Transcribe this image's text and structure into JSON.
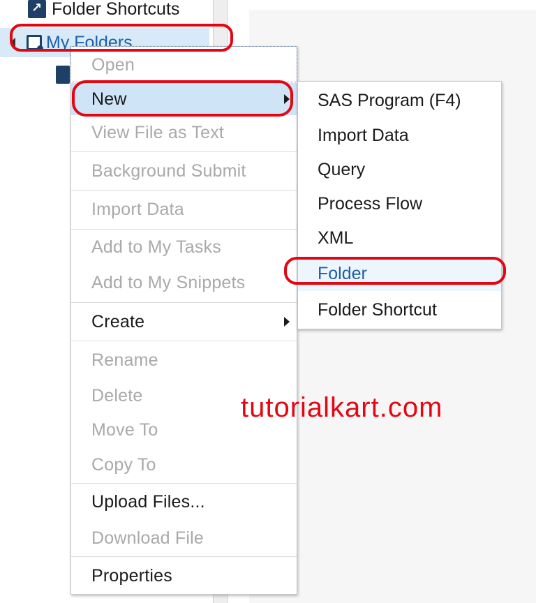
{
  "tree": {
    "folder_shortcuts_label": "Folder Shortcuts",
    "my_folders_label": "My Folders"
  },
  "context_menu": {
    "items": [
      {
        "label": "Open"
      },
      {
        "label": "New"
      },
      {
        "label": "View File as Text"
      },
      {
        "label": "Background Submit"
      },
      {
        "label": "Import Data"
      },
      {
        "label": "Add to My Tasks"
      },
      {
        "label": "Add to My Snippets"
      },
      {
        "label": "Create"
      },
      {
        "label": "Rename"
      },
      {
        "label": "Delete"
      },
      {
        "label": "Move To"
      },
      {
        "label": "Copy To"
      },
      {
        "label": "Upload Files..."
      },
      {
        "label": "Download File"
      },
      {
        "label": "Properties"
      }
    ]
  },
  "submenu": {
    "items": [
      {
        "label": "SAS Program (F4)"
      },
      {
        "label": "Import Data"
      },
      {
        "label": "Query"
      },
      {
        "label": "Process Flow"
      },
      {
        "label": "XML"
      },
      {
        "label": "Folder"
      },
      {
        "label": "Folder Shortcut"
      }
    ]
  },
  "watermark": "tutorialkart.com",
  "colors": {
    "highlight": "#e30613",
    "selection": "#cfe5f7",
    "link": "#1d5fa8",
    "disabled_text": "#a9a9a9"
  }
}
